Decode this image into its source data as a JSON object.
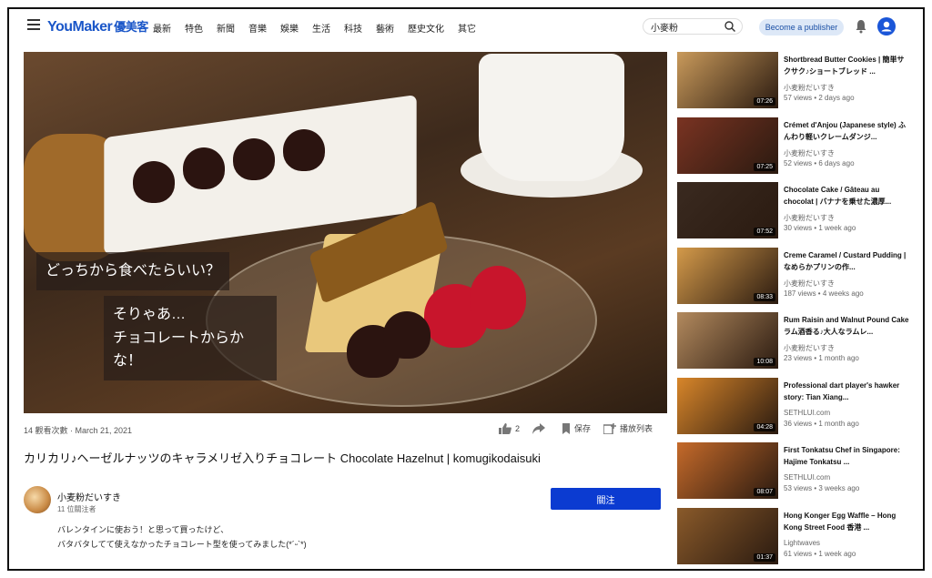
{
  "header": {
    "logo_text": "YouMaker",
    "logo_cn": "優美客",
    "nav": [
      "最新",
      "特色",
      "新聞",
      "音樂",
      "娛樂",
      "生活",
      "科技",
      "藝術",
      "歷史文化",
      "其它"
    ],
    "search_value": "小麥粉",
    "publisher_label": "Become a publisher"
  },
  "video": {
    "caption1": "どっちから食べたらいい？",
    "caption2_line1": "そりゃあ…",
    "caption2_line2": "チョコレートからかな！",
    "views_date": "14 觀看次數 · March 21, 2021",
    "likes": "2",
    "save_label": "保存",
    "playlist_label": "播放列表",
    "title": "カリカリ♪ヘーゼルナッツのキャラメリゼ入りチョコレート Chocolate Hazelnut | komugikodaisuki"
  },
  "channel": {
    "name": "小麦粉だいすき",
    "subs": "11 位關注者",
    "follow_label": "關注",
    "desc_line1": "バレンタインに使おう！と思って買ったけど、",
    "desc_line2": "バタバタしてて使えなかったチョコレート型を使ってみました(*´ᵕ`*)"
  },
  "sidebar": [
    {
      "title": "Shortbread Butter Cookies | 簡単サクサク♪ショートブレッド ...",
      "channel": "小麦粉だいすき",
      "stats": "57 views • 2 days ago",
      "duration": "07:26",
      "color": "#c99a5b"
    },
    {
      "title": "Crémet d'Anjou (Japanese style) ふんわり軽いクレームダンジ...",
      "channel": "小麦粉だいすき",
      "stats": "52 views • 6 days ago",
      "duration": "07:25",
      "color": "#7a3322"
    },
    {
      "title": "Chocolate Cake / Gâteau au chocolat | バナナを乗せた濃厚...",
      "channel": "小麦粉だいすき",
      "stats": "30 views • 1 week ago",
      "duration": "07:52",
      "color": "#3a2a20"
    },
    {
      "title": "Creme Caramel / Custard Pudding | なめらかプリンの作...",
      "channel": "小麦粉だいすき",
      "stats": "187 views • 4 weeks ago",
      "duration": "08:33",
      "color": "#d49a4a"
    },
    {
      "title": "Rum Raisin and Walnut Pound Cake ラム酒香る♪大人なラムレ...",
      "channel": "小麦粉だいすき",
      "stats": "23 views • 1 month ago",
      "duration": "10:08",
      "color": "#b38a5e"
    },
    {
      "title": "Professional dart player's hawker story: Tian Xiang...",
      "channel": "SETHLUI.com",
      "stats": "36 views • 1 month ago",
      "duration": "04:28",
      "color": "#d8862a"
    },
    {
      "title": "First Tonkatsu Chef in Singapore: Hajime Tonkatsu ...",
      "channel": "SETHLUI.com",
      "stats": "53 views • 3 weeks ago",
      "duration": "08:07",
      "color": "#c56a2a"
    },
    {
      "title": "Hong Konger Egg Waffle – Hong Kong Street Food 香港 ...",
      "channel": "Lightwaves",
      "stats": "61 views • 1 week ago",
      "duration": "01:37",
      "color": "#8a5a2a"
    }
  ]
}
